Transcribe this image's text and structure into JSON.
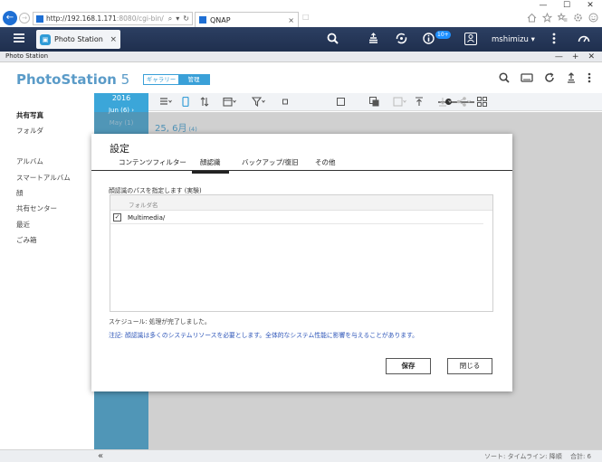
{
  "browser": {
    "url": "http://192.168.1.171",
    "url_port": ":8080/cgi-bin/",
    "tab_title": "QNAP",
    "tab_close": "×",
    "new_tab": "□",
    "back": "←",
    "forward": "→",
    "win_min": "—",
    "win_max": "☐",
    "win_close": "✕",
    "search_glyph": "⌕",
    "dropdown_glyph": "▾",
    "refresh_glyph": "↻",
    "icons": [
      "home-icon",
      "star-icon",
      "favorites-icon",
      "settings-icon",
      "smiley-icon"
    ]
  },
  "topbar": {
    "app_tab_label": "Photo Station",
    "app_tab_close": "×",
    "badge": "10+",
    "user_name": "mshimizu ▾",
    "icons": [
      "search-icon",
      "stack-icon",
      "sync-icon",
      "info-icon",
      "user-icon",
      "more-icon",
      "dashboard-icon"
    ]
  },
  "app_window": {
    "title": "Photo Station",
    "ctrl_min": "—",
    "ctrl_max": "+",
    "ctrl_close": "✕"
  },
  "header": {
    "logo": "PhotoStation",
    "version": " 5",
    "seg_gallery": "ギャラリー",
    "seg_manage": "管理",
    "tool_icons": [
      "search-icon",
      "slideshow-icon",
      "refresh-icon",
      "upload-icon",
      "more-icon"
    ]
  },
  "sidebar": {
    "items": [
      "共有写真",
      "フォルダ",
      "アルバム",
      "スマートアルバム",
      "顔",
      "共有センター",
      "最近",
      "ごみ箱"
    ]
  },
  "timeline": {
    "year": "2016",
    "months": [
      {
        "label": "Jun (6) ›",
        "dim": false
      },
      {
        "label": "May (1)",
        "dim": true
      }
    ]
  },
  "content": {
    "date_heading": "25, 6月",
    "date_count": " (4)"
  },
  "statusbar": {
    "collapse": "«",
    "info": "ソート: タイムライン: 降順　 合計: 6"
  },
  "dialog": {
    "title": "設定",
    "tabs": [
      "コンテンツフィルター",
      "顔認識",
      "バックアップ/復旧",
      "その他"
    ],
    "active_tab": 1,
    "description": "顔認識のパスを指定します (実験)",
    "folder_column": "フォルダ名",
    "folders": [
      {
        "checked": true,
        "name": "Multimedia/"
      }
    ],
    "check_glyph": "✓",
    "schedule": "スケジュール: 処理が完了しました。",
    "note": "注記: 顔認識は多くのシステムリソースを必要とします。全体的なシステム性能に影響を与えることがあります。",
    "save_label": "保存",
    "close_label": "閉じる"
  }
}
